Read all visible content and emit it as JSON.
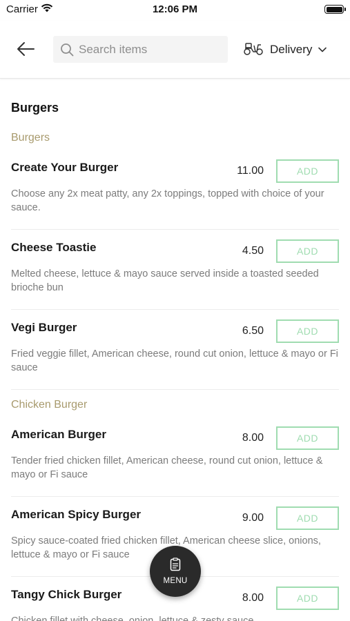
{
  "status_bar": {
    "carrier": "Carrier",
    "time": "12:06 PM",
    "wifi_icon": "wifi-icon",
    "battery_icon": "battery-icon"
  },
  "header": {
    "back_icon": "arrow-left-icon",
    "search": {
      "placeholder": "Search items",
      "value": "",
      "icon": "search-icon"
    },
    "delivery": {
      "label": "Delivery",
      "icon": "scooter-icon",
      "chevron": "chevron-down-icon"
    }
  },
  "menu": {
    "section_title": "Burgers",
    "categories": [
      {
        "title": "Burgers",
        "items": [
          {
            "name": "Create Your Burger",
            "price": "11.00",
            "add_label": "ADD",
            "description": "Choose any 2x meat patty, any 2x toppings, topped with choice of your sauce."
          },
          {
            "name": "Cheese Toastie",
            "price": "4.50",
            "add_label": "ADD",
            "description": "Melted cheese, lettuce & mayo sauce served inside a toasted seeded brioche bun"
          },
          {
            "name": "Vegi Burger",
            "price": "6.50",
            "add_label": "ADD",
            "description": "Fried veggie fillet, American cheese, round cut onion, lettuce & mayo or Fi sauce"
          }
        ]
      },
      {
        "title": "Chicken Burger",
        "items": [
          {
            "name": "American Burger",
            "price": "8.00",
            "add_label": "ADD",
            "description": "Tender fried chicken fillet, American cheese, round cut onion, lettuce & mayo or Fi sauce"
          },
          {
            "name": "American Spicy Burger",
            "price": "9.00",
            "add_label": "ADD",
            "description": "Spicy sauce-coated fried chicken fillet, American cheese slice, onions, lettuce & mayo or Fi sauce"
          },
          {
            "name": "Tangy Chick Burger",
            "price": "8.00",
            "add_label": "ADD",
            "description": "Chicken fillet with cheese, onion, lettuce & zesty sauce"
          }
        ]
      }
    ]
  },
  "fab": {
    "label": "MENU",
    "icon": "menu-list-icon"
  },
  "colors": {
    "accent_green": "#9fdcb0",
    "category_gold": "#a89a6d",
    "fab_dark": "#2a2a2a",
    "muted_text": "#7b7b7b"
  }
}
